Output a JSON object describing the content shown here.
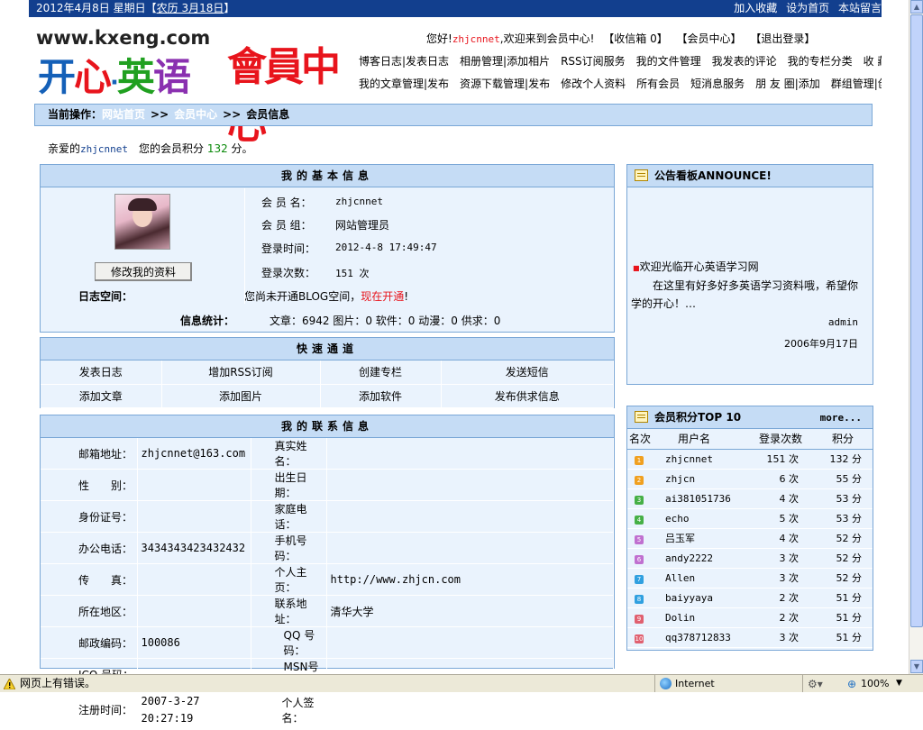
{
  "topbar": {
    "date": "2012年4月8日 星期日【",
    "lunar": "农历 3月18日",
    "date_end": "】",
    "links": [
      "加入收藏",
      "设为首页",
      "本站留言"
    ]
  },
  "logo": {
    "url": "www.kxeng.com",
    "chars": [
      "开",
      "心",
      "·",
      "英",
      "语"
    ],
    "member": "會員中心"
  },
  "welcome": {
    "greeting": "您好!",
    "username": "zhjcnnet",
    "text": ",欢迎来到会员中心!",
    "links": [
      "【收信箱 0】",
      "【会员中心】",
      "【退出登录】"
    ]
  },
  "nav": {
    "row1": "博客日志|发表日志　相册管理|添加相片　RSS订阅服务　我的文件管理　我发表的评论　我的专栏分类　收 藏 夹",
    "row2": "我的文章管理|发布　资源下载管理|发布　修改个人资料　所有会员　短消息服务　朋 友 圈|添加　群组管理|创建"
  },
  "crumb": {
    "label": "当前操作：",
    "home": "网站首页",
    "sep": ">>",
    "center": "会员中心",
    "current": "会员信息"
  },
  "hello": {
    "prefix": "亲爱的",
    "user": "zhjcnnet",
    "mid": "　您的会员积分 ",
    "points": "132",
    "suffix": " 分。"
  },
  "basic": {
    "title": "我的基本信息",
    "edit_button": "修改我的资料",
    "fields": [
      {
        "label": "会 员 名：",
        "value": "zhjcnnet"
      },
      {
        "label": "会 员 组：",
        "value": "网站管理员"
      },
      {
        "label": "登录时间：",
        "value": "2012-4-8 17:49:47"
      },
      {
        "label": "登录次数：",
        "value": "151 次"
      }
    ],
    "blog_label": "日志空间：",
    "blog_text": "您尚未开通BLOG空间，",
    "blog_link": "现在开通",
    "blog_end": "!",
    "stats_label": "信息统计：",
    "stats": "文章：6942 图片：0 软件：0 动漫：0 供求：0"
  },
  "quick": {
    "title": "快速通道",
    "items": [
      [
        "发表日志",
        "增加RSS订阅",
        "创建专栏",
        "发送短信"
      ],
      [
        "添加文章",
        "添加图片",
        "添加软件",
        "发布供求信息"
      ]
    ]
  },
  "contact": {
    "title": "我的联系信息",
    "rows": [
      [
        "邮箱地址：",
        "zhjcnnet@163.com",
        "真实姓名：",
        ""
      ],
      [
        "性　　别：",
        "",
        "出生日期：",
        ""
      ],
      [
        "身份证号：",
        "",
        "家庭电话：",
        ""
      ],
      [
        "办公电话：",
        "3434343423432432",
        "手机号码：",
        ""
      ],
      [
        "传　　真：",
        "",
        "个人主页：",
        "http://www.zhjcn.com"
      ],
      [
        "所在地区：",
        "",
        "联系地址：",
        "清华大学"
      ],
      [
        "邮政编码：",
        "100086",
        "QQ 号码：",
        ""
      ],
      [
        "ICQ 号码：",
        "",
        "MSN号码：",
        ""
      ],
      [
        "注册时间：",
        "2007-3-27 20:27:19",
        "个人签名：",
        ""
      ]
    ]
  },
  "announce": {
    "title": "公告看板ANNOUNCE!",
    "headline": "欢迎光临开心英语学习网",
    "body": "　　在这里有好多好多英语学习资料哦，希望你学的开心！…",
    "author": "admin",
    "date": "2006年9月17日"
  },
  "top10": {
    "title": "会员积分TOP 10",
    "more": "more...",
    "headers": [
      "名次",
      "用户名",
      "登录次数",
      "积分"
    ],
    "rows": [
      {
        "rank": "1",
        "name": "zhjcnnet",
        "logins": "151 次",
        "points": "132 分",
        "color": "#f0a020"
      },
      {
        "rank": "2",
        "name": "zhjcn",
        "logins": "6 次",
        "points": "55 分",
        "color": "#f0a020"
      },
      {
        "rank": "3",
        "name": "ai381051736",
        "logins": "4 次",
        "points": "53 分",
        "color": "#46b046"
      },
      {
        "rank": "4",
        "name": "echo",
        "logins": "5 次",
        "points": "53 分",
        "color": "#46b046"
      },
      {
        "rank": "5",
        "name": "吕玉军",
        "logins": "4 次",
        "points": "52 分",
        "color": "#c070d0"
      },
      {
        "rank": "6",
        "name": "andy2222",
        "logins": "3 次",
        "points": "52 分",
        "color": "#c070d0"
      },
      {
        "rank": "7",
        "name": "Allen",
        "logins": "3 次",
        "points": "52 分",
        "color": "#30a0e0"
      },
      {
        "rank": "8",
        "name": "baiyyaya",
        "logins": "2 次",
        "points": "51 分",
        "color": "#30a0e0"
      },
      {
        "rank": "9",
        "name": "Dolin",
        "logins": "2 次",
        "points": "51 分",
        "color": "#e06070"
      },
      {
        "rank": "10",
        "name": "qq378712833",
        "logins": "3 次",
        "points": "51 分",
        "color": "#e06070"
      }
    ]
  },
  "statusbar": {
    "error": "网页上有错误。",
    "zone": "Internet",
    "zoom": "100%"
  }
}
